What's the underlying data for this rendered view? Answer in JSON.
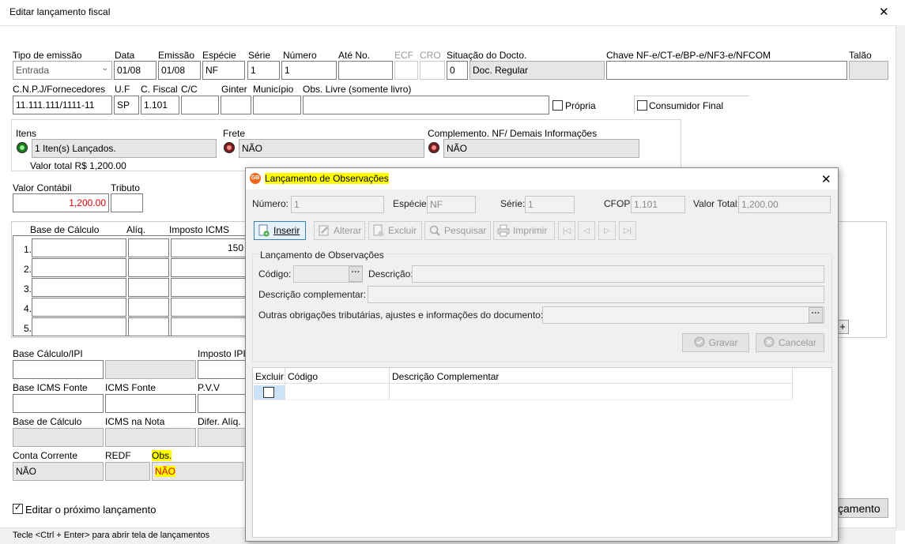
{
  "window": {
    "title": "Editar lançamento fiscal",
    "close": "✕"
  },
  "form": {
    "tipo_emissao": {
      "label": "Tipo de emissão",
      "value": "Entrada"
    },
    "data": {
      "label": "Data",
      "value": "01/08"
    },
    "emissao": {
      "label": "Emissão",
      "value": "01/08"
    },
    "especie": {
      "label": "Espécie",
      "value": "NF"
    },
    "serie": {
      "label": "Série",
      "value": "1"
    },
    "numero": {
      "label": "Número",
      "value": "1"
    },
    "ate_no": {
      "label": "Até No."
    },
    "ecf": {
      "label": "ECF"
    },
    "cro": {
      "label": "CRO"
    },
    "situacao": {
      "label": "Situação do Docto.",
      "code": "0",
      "value": "Doc. Regular"
    },
    "chave": {
      "label": "Chave NF-e/CT-e/BP-e/NF3-e/NFCOM"
    },
    "talao": {
      "label": "Talão"
    },
    "cnpj": {
      "label": "C.N.P.J/Fornecedores",
      "value": "11.111.111/1111-11"
    },
    "uf": {
      "label": "U.F",
      "value": "SP"
    },
    "cfiscal": {
      "label": "C. Fiscal",
      "value": "1.101"
    },
    "cc": {
      "label": "C/C"
    },
    "ginter": {
      "label": "Ginter"
    },
    "municipio": {
      "label": "Município"
    },
    "obs_livre": {
      "label": "Obs. Livre (somente livro)"
    },
    "propria": {
      "label": "Própria"
    },
    "consumidor": {
      "label": "Consumidor Final"
    },
    "itens": {
      "label": "Itens",
      "value": "1 Iten(s) Lançados.",
      "total": "Valor total R$ 1,200.00"
    },
    "frete": {
      "label": "Frete",
      "value": "NÃO"
    },
    "complemento": {
      "label": "Complemento. NF/ Demais Informações",
      "value": "NÃO"
    },
    "valor_contabil": {
      "label": "Valor Contábil",
      "value": "1,200.00"
    },
    "tributo": {
      "label": "Tributo"
    },
    "base_calc_hdr": "Base de Cálculo",
    "aliq_hdr": "Alíq.",
    "imposto_icms_hdr": "Imposto ICMS",
    "rows": [
      "1.",
      "2.",
      "3.",
      "4.",
      "5."
    ],
    "row1_imposto": "150",
    "plus": "+",
    "base_ipi": {
      "label": "Base Cálculo/IPI"
    },
    "imposto_ipi": {
      "label": "Imposto IPI"
    },
    "base_icms_fonte": {
      "label": "Base ICMS Fonte"
    },
    "icms_fonte": {
      "label": "ICMS Fonte"
    },
    "pvv": {
      "label": "P.V.V"
    },
    "base_calculo": {
      "label": "Base de Cálculo"
    },
    "icms_nota": {
      "label": "ICMS na Nota"
    },
    "difer": {
      "label": "Difer. Alíq."
    },
    "conta_corrente": {
      "label": "Conta Corrente",
      "value": "NÃO"
    },
    "redf": {
      "label": "REDF"
    },
    "obs": {
      "label": "Obs.",
      "value": "NÃO"
    },
    "editar_proximo": {
      "label": "Editar o próximo lançamento"
    },
    "lancamento_btn": "çamento",
    "status": "Tecle <Ctrl + Enter> para abrir tela de lançamentos"
  },
  "dialog": {
    "title": "Lançamento de Observações",
    "close": "✕",
    "numero": {
      "label": "Número:",
      "value": "1"
    },
    "especie": {
      "label": "Espécie:",
      "value": "NF"
    },
    "serie": {
      "label": "Série:",
      "value": "1"
    },
    "cfop": {
      "label": "CFOP:",
      "value": "1.101"
    },
    "valor_total": {
      "label": "Valor Total:",
      "value": "1,200.00"
    },
    "toolbar": {
      "inserir": "Inserir",
      "alterar": "Alterar",
      "excluir": "Excluir",
      "pesquisar": "Pesquisar",
      "imprimir": "Imprimir"
    },
    "group_title": "Lançamento de Observações",
    "codigo": {
      "label": "Código:"
    },
    "descricao": {
      "label": "Descrição:"
    },
    "desc_comp": {
      "label": "Descrição complementar:"
    },
    "outras": {
      "label": "Outras obrigações tributárias, ajustes e informações do documento:"
    },
    "ellipsis": "···",
    "gravar": "Gravar",
    "cancelar": "Cancelar",
    "grid": {
      "headers": [
        "Excluir",
        "Código",
        "Descrição Complementar"
      ]
    }
  }
}
